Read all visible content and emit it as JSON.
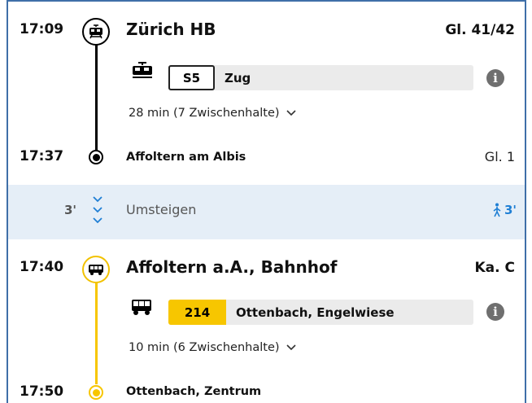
{
  "leg1": {
    "dep_time": "17:09",
    "dep_stop": "Zürich HB",
    "dep_platform": "Gl. 41/42",
    "line_badge": "S5",
    "line_desc": "Zug",
    "duration": "28 min (7 Zwischenhalte)",
    "arr_time": "17:37",
    "arr_stop": "Affoltern am Albis",
    "arr_platform": "Gl. 1",
    "icon": "train-icon",
    "line_color": "#000000"
  },
  "transfer": {
    "minutes": "3'",
    "label": "Umsteigen",
    "walk_minutes": "3'",
    "icon": "walk-icon",
    "accent": "#1f7fd4"
  },
  "leg2": {
    "dep_time": "17:40",
    "dep_stop": "Affoltern a.A., Bahnhof",
    "dep_platform": "Ka. C",
    "line_badge": "214",
    "line_desc": "Ottenbach, Engelwiese",
    "duration": "10 min (6 Zwischenhalte)",
    "arr_time": "17:50",
    "arr_stop": "Ottenbach, Zentrum",
    "icon": "bus-icon",
    "line_color": "#f7c600"
  }
}
